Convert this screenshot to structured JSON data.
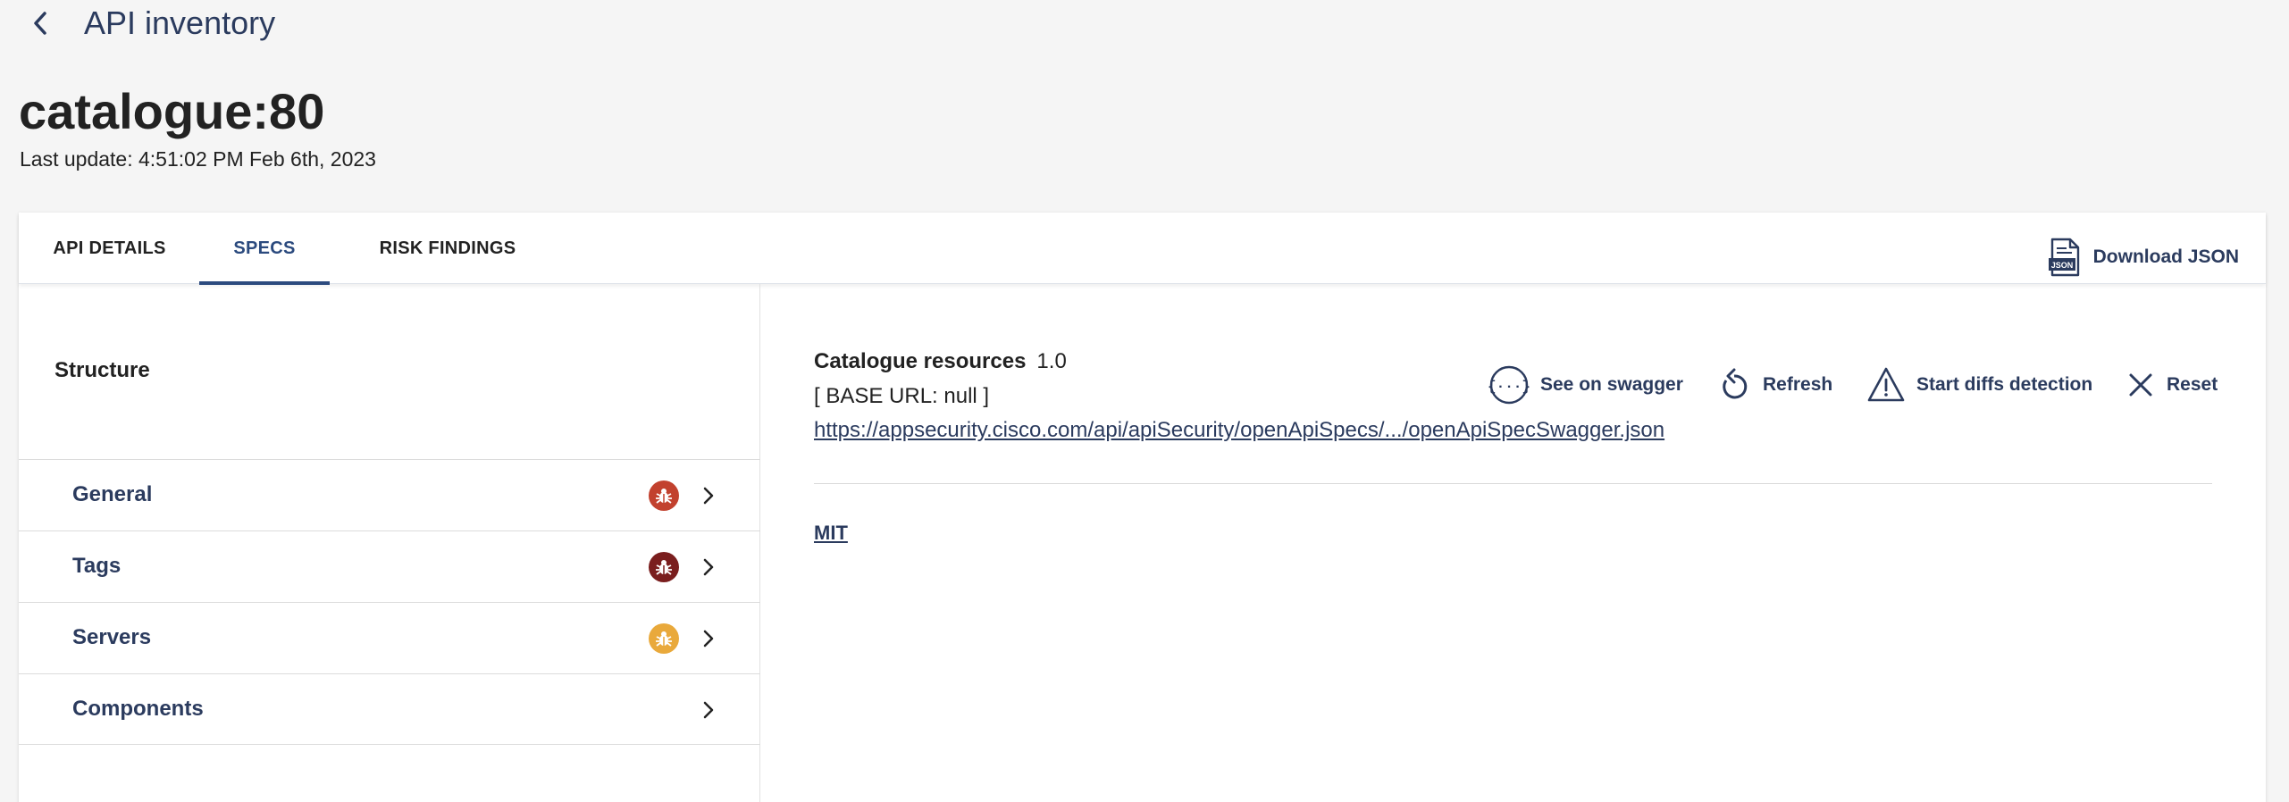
{
  "header": {
    "back_icon": "chevron-left-icon",
    "title": "API inventory"
  },
  "page": {
    "title": "catalogue:80",
    "last_update": "Last update: 4:51:02 PM Feb 6th, 2023"
  },
  "tabs": [
    {
      "label": "API DETAILS",
      "active": false
    },
    {
      "label": "SPECS",
      "active": true
    },
    {
      "label": "RISK FINDINGS",
      "active": false
    }
  ],
  "download": {
    "label": "Download JSON",
    "icon_text": "JSON",
    "icon": "json-file-icon"
  },
  "structure": {
    "title": "Structure",
    "items": [
      {
        "label": "General",
        "badge_color": "#c2412e",
        "badge": "bug-icon"
      },
      {
        "label": "Tags",
        "badge_color": "#7a1e1e",
        "badge": "bug-icon"
      },
      {
        "label": "Servers",
        "badge_color": "#e9a93b",
        "badge": "bug-icon"
      },
      {
        "label": "Components",
        "badge_color": null,
        "badge": null
      }
    ]
  },
  "spec": {
    "title": "Catalogue resources",
    "version": "1.0",
    "base_url": "[ BASE URL: null ]",
    "link": "https://appsecurity.cisco.com/api/apiSecurity/openApiSpecs/.../openApiSpecSwagger.json",
    "license": "MIT"
  },
  "actions": {
    "swagger": "See on swagger",
    "refresh": "Refresh",
    "diffs": "Start diffs detection",
    "reset": "Reset"
  },
  "colors": {
    "accent": "#2b4a7e",
    "text_dark": "#2b3b5e"
  }
}
